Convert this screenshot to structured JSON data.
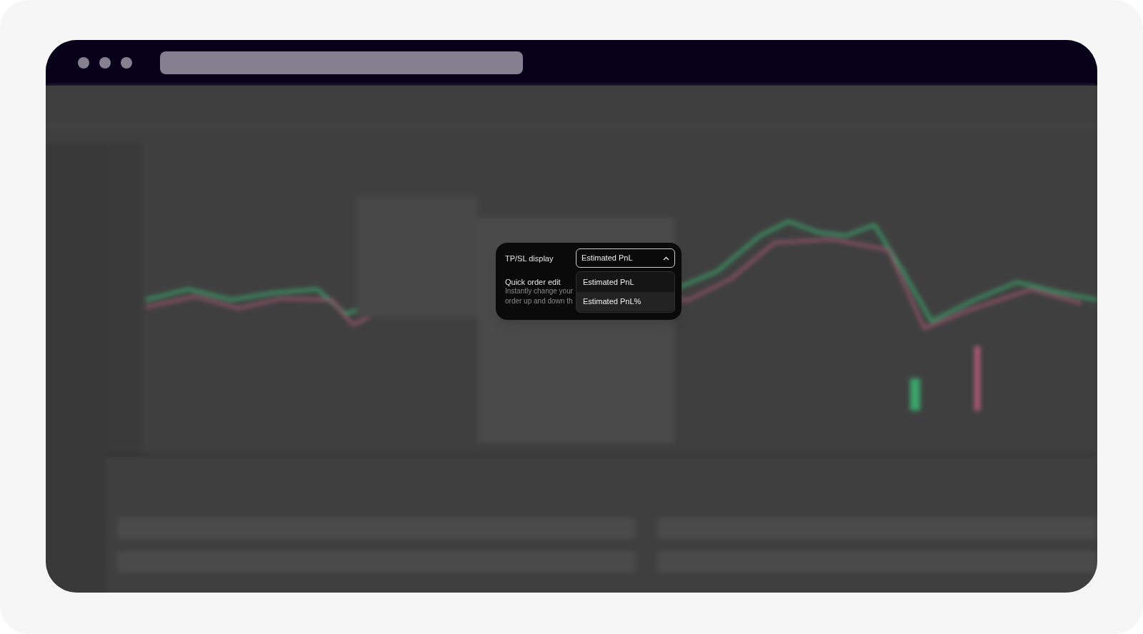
{
  "tpsl_display": {
    "label": "TP/SL display",
    "value": "Estimated PnL",
    "expanded": true,
    "options": [
      {
        "label": "Estimated PnL",
        "highlighted": false
      },
      {
        "label": "Estimated PnL%",
        "highlighted": true
      }
    ]
  },
  "quick_order_edit": {
    "label": "Quick order edit",
    "description_lines": [
      "Instantly change your",
      "order up and down th"
    ]
  }
}
